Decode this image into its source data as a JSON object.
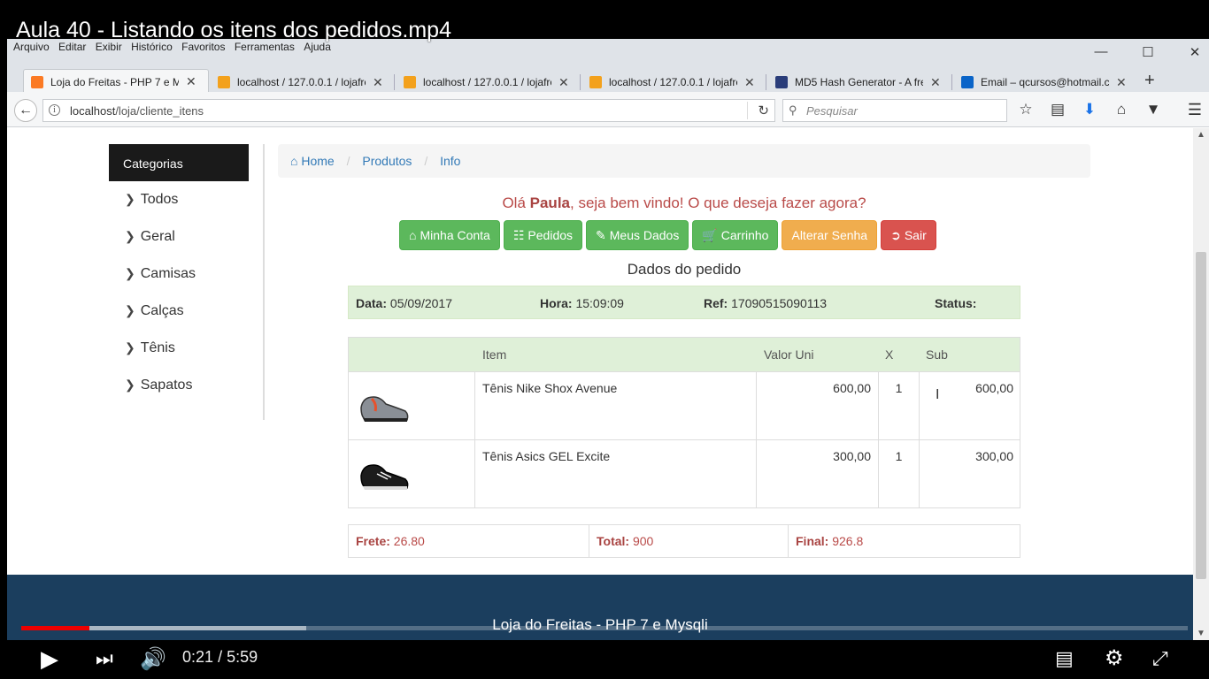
{
  "video": {
    "title": "Aula 40 - Listando os itens dos pedidos.mp4",
    "current_time": "0:21",
    "separator": "/",
    "duration": "5:59",
    "progress_fraction": 0.0585
  },
  "browser": {
    "menu": [
      "Arquivo",
      "Editar",
      "Exibir",
      "Histórico",
      "Favoritos",
      "Ferramentas",
      "Ajuda"
    ],
    "tabs": [
      {
        "label": "Loja do Freitas - PHP 7 e My",
        "active": true
      },
      {
        "label": "localhost / 127.0.0.1 / lojafre",
        "active": false
      },
      {
        "label": "localhost / 127.0.0.1 / lojafre",
        "active": false
      },
      {
        "label": "localhost / 127.0.0.1 / lojafre",
        "active": false
      },
      {
        "label": "MD5 Hash Generator - A free",
        "active": false
      },
      {
        "label": "Email – qcursos@hotmail.co",
        "active": false
      }
    ],
    "url_host": "localhost",
    "url_path": "/loja/cliente_itens",
    "search_placeholder": "Pesquisar"
  },
  "sidebar": {
    "title": "Categorias",
    "items": [
      "Todos",
      "Geral",
      "Camisas",
      "Calças",
      "Tênis",
      "Sapatos"
    ]
  },
  "breadcrumb": [
    "Home",
    "Produtos",
    "Info"
  ],
  "welcome": {
    "prefix": "Olá ",
    "name": "Paula",
    "suffix": ", seja bem vindo! O que deseja fazer agora?"
  },
  "actions": {
    "minha_conta": "Minha Conta",
    "pedidos": "Pedidos",
    "meus_dados": "Meus Dados",
    "carrinho": "Carrinho",
    "alterar_senha": "Alterar Senha",
    "sair": "Sair"
  },
  "order": {
    "title": "Dados do pedido",
    "date_label": "Data:",
    "date": "05/09/2017",
    "time_label": "Hora:",
    "time": "15:09:09",
    "ref_label": "Ref:",
    "ref": "17090515090113",
    "status_label": "Status:",
    "status": ""
  },
  "items_table": {
    "headers": {
      "item": "Item",
      "unit": "Valor Uni",
      "qty": "X",
      "sub": "Sub"
    },
    "rows": [
      {
        "name": "Tênis Nike Shox Avenue",
        "unit": "600,00",
        "qty": "1",
        "sub": "600,00",
        "color": "#8a8f96"
      },
      {
        "name": "Tênis Asics GEL Excite",
        "unit": "300,00",
        "qty": "1",
        "sub": "300,00",
        "color": "#1c1c1c"
      }
    ]
  },
  "totals": {
    "frete_label": "Frete:",
    "frete": "26.80",
    "total_label": "Total:",
    "total": "900",
    "final_label": "Final:",
    "final": "926.8"
  },
  "footer": {
    "text": "Loja do Freitas - PHP 7 e Mysqli"
  }
}
